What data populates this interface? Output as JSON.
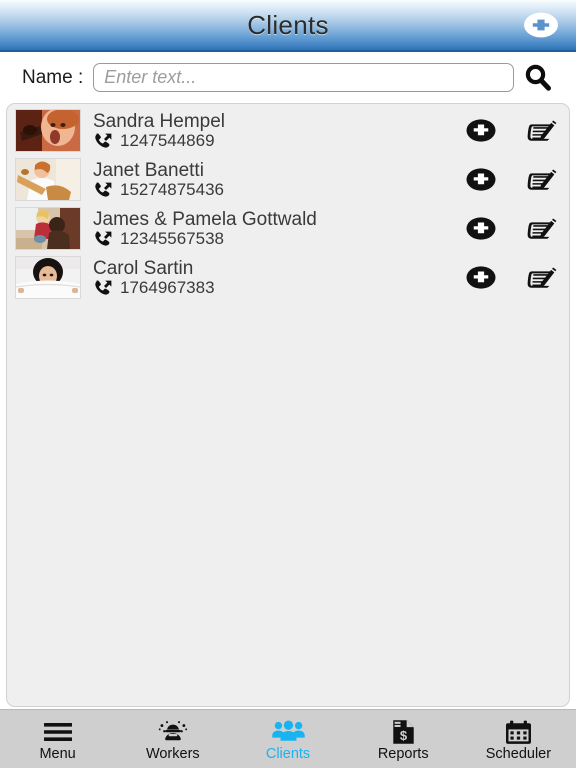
{
  "header": {
    "title": "Clients",
    "add_icon": "plus-circle-icon"
  },
  "search": {
    "label": "Name :",
    "placeholder": "Enter text...",
    "value": "",
    "button_icon": "search-icon"
  },
  "list": {
    "row_add_icon": "plus-circle-icon",
    "row_edit_icon": "edit-documents-icon",
    "phone_icon": "phone-outgoing-icon",
    "clients": [
      {
        "name": "Sandra Hempel",
        "phone": "1247544869",
        "avatar": "photo-woman-surprised"
      },
      {
        "name": "Janet Banetti",
        "phone": "15274875436",
        "avatar": "photo-woman-kitchen"
      },
      {
        "name": "James & Pamela Gottwald",
        "phone": "12345567538",
        "avatar": "photo-couple-floor"
      },
      {
        "name": "Carol Sartin",
        "phone": "1764967383",
        "avatar": "photo-woman-bed"
      }
    ]
  },
  "tabbar": {
    "active_color": "#18b4f2",
    "items": [
      {
        "label": "Menu",
        "icon": "hamburger-menu-icon",
        "active": false
      },
      {
        "label": "Workers",
        "icon": "worker-hardhat-icon",
        "active": false
      },
      {
        "label": "Clients",
        "icon": "people-group-icon",
        "active": true
      },
      {
        "label": "Reports",
        "icon": "document-dollar-icon",
        "active": false
      },
      {
        "label": "Scheduler",
        "icon": "calendar-icon",
        "active": false
      }
    ]
  }
}
